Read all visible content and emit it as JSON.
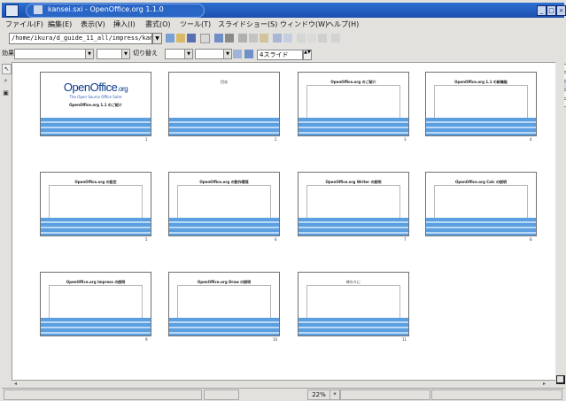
{
  "window": {
    "title": "kansei.sxi - OpenOffice.org 1.1.0"
  },
  "menu": {
    "items": [
      {
        "label": "ファイル(F)"
      },
      {
        "label": "編集(E)"
      },
      {
        "label": "表示(V)"
      },
      {
        "label": "挿入(I)"
      },
      {
        "label": "書式(O)"
      },
      {
        "label": "ツール(T)"
      },
      {
        "label": "スライドショー(S)"
      },
      {
        "label": "ウィンドウ(W)"
      },
      {
        "label": "ヘルプ(H)"
      }
    ]
  },
  "function_bar": {
    "url_value": "/home/ikura/d_guide_11_all/impress/kansei.sxi"
  },
  "object_bar": {
    "effect_label": "効果",
    "transition_label": "切り替え",
    "slides_value": "4スライド"
  },
  "slides": [
    {
      "title": "",
      "logo": "OpenOffice",
      "logo_suffix": ".org",
      "tagline": "The Open Source Office Suite",
      "subtitle": "OpenOffice.org 1.1 のご紹介",
      "number": "1"
    },
    {
      "title": "目次",
      "number": "2"
    },
    {
      "title": "OpenOffice.org のご紹介",
      "number": "3"
    },
    {
      "title": "OpenOffice.org 1.1 の新機能",
      "number": "4"
    },
    {
      "title": "OpenOffice.org の設定",
      "number": "5"
    },
    {
      "title": "OpenOffice.org の動作環境",
      "number": "6"
    },
    {
      "title": "OpenOffice.org Writer の説明",
      "number": "7"
    },
    {
      "title": "OpenOffice.org Calc の説明",
      "number": "8"
    },
    {
      "title": "OpenOffice.org Impress の説明",
      "number": "9"
    },
    {
      "title": "OpenOffice.org Draw の説明",
      "number": "10"
    },
    {
      "title": "終わりに",
      "number": "11"
    }
  ],
  "status_bar": {
    "zoom": "22%",
    "marker": "*"
  },
  "colors": {
    "title_bar": "#2d6fd0",
    "slide_stripe": "#5b9fe1",
    "logo": "#0b3a8a"
  }
}
